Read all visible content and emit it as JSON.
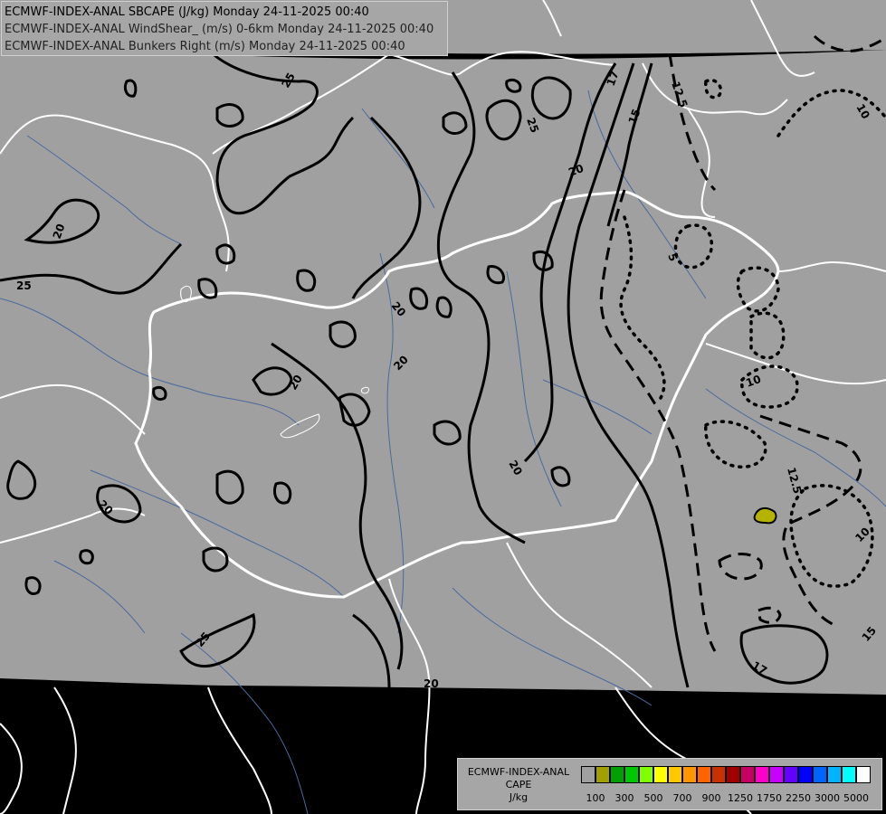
{
  "titles": [
    "ECMWF-INDEX-ANAL SBCAPE (J/kg) Monday 24-11-2025 00:40",
    "ECMWF-INDEX-ANAL WindShear_ (m/s) 0-6km Monday 24-11-2025 00:40",
    "ECMWF-INDEX-ANAL Bunkers Right (m/s) Monday 24-11-2025 00:40"
  ],
  "legend": {
    "title_line1": "ECMWF-INDEX-ANAL",
    "title_line2": "CAPE",
    "title_line3": "J/kg",
    "colors": [
      "#a0a0a0",
      "#a0a000",
      "#00a000",
      "#00c800",
      "#80ff00",
      "#ffff00",
      "#ffc800",
      "#ff9600",
      "#ff6400",
      "#c83200",
      "#a00000",
      "#c80064",
      "#ff00c8",
      "#c800ff",
      "#6400ff",
      "#0000ff",
      "#0064ff",
      "#00b4ff",
      "#00ffff",
      "#ffffff"
    ],
    "ticks": [
      "100",
      "300",
      "500",
      "700",
      "900",
      "1250",
      "1750",
      "2250",
      "3000",
      "5000"
    ]
  },
  "contour_labels": [
    "25",
    "25",
    "20",
    "20",
    "17",
    "15",
    "12.5",
    "10",
    "5",
    "20",
    "20",
    "20",
    "20",
    "25",
    "20",
    "10",
    "12.5",
    "10",
    "17",
    "15",
    "20",
    "25"
  ],
  "colors": {
    "map_background": "#a0a0a0",
    "outside_domain": "#000000",
    "borders": "#ffffff",
    "rivers": "#4a6a9c",
    "contours": "#000000",
    "cape_cell": "#b4b400"
  }
}
